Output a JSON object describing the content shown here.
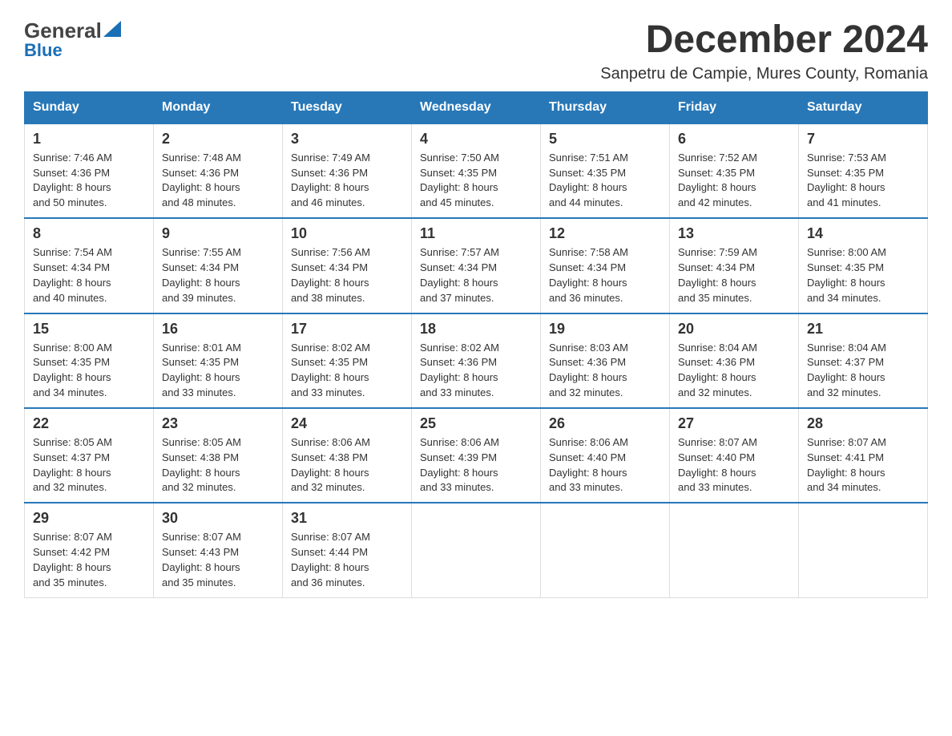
{
  "logo": {
    "general": "General",
    "blue": "Blue"
  },
  "header": {
    "title": "December 2024",
    "subtitle": "Sanpetru de Campie, Mures County, Romania"
  },
  "days_of_week": [
    "Sunday",
    "Monday",
    "Tuesday",
    "Wednesday",
    "Thursday",
    "Friday",
    "Saturday"
  ],
  "weeks": [
    [
      {
        "num": "1",
        "sunrise": "7:46 AM",
        "sunset": "4:36 PM",
        "daylight": "8 hours and 50 minutes."
      },
      {
        "num": "2",
        "sunrise": "7:48 AM",
        "sunset": "4:36 PM",
        "daylight": "8 hours and 48 minutes."
      },
      {
        "num": "3",
        "sunrise": "7:49 AM",
        "sunset": "4:36 PM",
        "daylight": "8 hours and 46 minutes."
      },
      {
        "num": "4",
        "sunrise": "7:50 AM",
        "sunset": "4:35 PM",
        "daylight": "8 hours and 45 minutes."
      },
      {
        "num": "5",
        "sunrise": "7:51 AM",
        "sunset": "4:35 PM",
        "daylight": "8 hours and 44 minutes."
      },
      {
        "num": "6",
        "sunrise": "7:52 AM",
        "sunset": "4:35 PM",
        "daylight": "8 hours and 42 minutes."
      },
      {
        "num": "7",
        "sunrise": "7:53 AM",
        "sunset": "4:35 PM",
        "daylight": "8 hours and 41 minutes."
      }
    ],
    [
      {
        "num": "8",
        "sunrise": "7:54 AM",
        "sunset": "4:34 PM",
        "daylight": "8 hours and 40 minutes."
      },
      {
        "num": "9",
        "sunrise": "7:55 AM",
        "sunset": "4:34 PM",
        "daylight": "8 hours and 39 minutes."
      },
      {
        "num": "10",
        "sunrise": "7:56 AM",
        "sunset": "4:34 PM",
        "daylight": "8 hours and 38 minutes."
      },
      {
        "num": "11",
        "sunrise": "7:57 AM",
        "sunset": "4:34 PM",
        "daylight": "8 hours and 37 minutes."
      },
      {
        "num": "12",
        "sunrise": "7:58 AM",
        "sunset": "4:34 PM",
        "daylight": "8 hours and 36 minutes."
      },
      {
        "num": "13",
        "sunrise": "7:59 AM",
        "sunset": "4:34 PM",
        "daylight": "8 hours and 35 minutes."
      },
      {
        "num": "14",
        "sunrise": "8:00 AM",
        "sunset": "4:35 PM",
        "daylight": "8 hours and 34 minutes."
      }
    ],
    [
      {
        "num": "15",
        "sunrise": "8:00 AM",
        "sunset": "4:35 PM",
        "daylight": "8 hours and 34 minutes."
      },
      {
        "num": "16",
        "sunrise": "8:01 AM",
        "sunset": "4:35 PM",
        "daylight": "8 hours and 33 minutes."
      },
      {
        "num": "17",
        "sunrise": "8:02 AM",
        "sunset": "4:35 PM",
        "daylight": "8 hours and 33 minutes."
      },
      {
        "num": "18",
        "sunrise": "8:02 AM",
        "sunset": "4:36 PM",
        "daylight": "8 hours and 33 minutes."
      },
      {
        "num": "19",
        "sunrise": "8:03 AM",
        "sunset": "4:36 PM",
        "daylight": "8 hours and 32 minutes."
      },
      {
        "num": "20",
        "sunrise": "8:04 AM",
        "sunset": "4:36 PM",
        "daylight": "8 hours and 32 minutes."
      },
      {
        "num": "21",
        "sunrise": "8:04 AM",
        "sunset": "4:37 PM",
        "daylight": "8 hours and 32 minutes."
      }
    ],
    [
      {
        "num": "22",
        "sunrise": "8:05 AM",
        "sunset": "4:37 PM",
        "daylight": "8 hours and 32 minutes."
      },
      {
        "num": "23",
        "sunrise": "8:05 AM",
        "sunset": "4:38 PM",
        "daylight": "8 hours and 32 minutes."
      },
      {
        "num": "24",
        "sunrise": "8:06 AM",
        "sunset": "4:38 PM",
        "daylight": "8 hours and 32 minutes."
      },
      {
        "num": "25",
        "sunrise": "8:06 AM",
        "sunset": "4:39 PM",
        "daylight": "8 hours and 33 minutes."
      },
      {
        "num": "26",
        "sunrise": "8:06 AM",
        "sunset": "4:40 PM",
        "daylight": "8 hours and 33 minutes."
      },
      {
        "num": "27",
        "sunrise": "8:07 AM",
        "sunset": "4:40 PM",
        "daylight": "8 hours and 33 minutes."
      },
      {
        "num": "28",
        "sunrise": "8:07 AM",
        "sunset": "4:41 PM",
        "daylight": "8 hours and 34 minutes."
      }
    ],
    [
      {
        "num": "29",
        "sunrise": "8:07 AM",
        "sunset": "4:42 PM",
        "daylight": "8 hours and 35 minutes."
      },
      {
        "num": "30",
        "sunrise": "8:07 AM",
        "sunset": "4:43 PM",
        "daylight": "8 hours and 35 minutes."
      },
      {
        "num": "31",
        "sunrise": "8:07 AM",
        "sunset": "4:44 PM",
        "daylight": "8 hours and 36 minutes."
      },
      null,
      null,
      null,
      null
    ]
  ],
  "labels": {
    "sunrise": "Sunrise: ",
    "sunset": "Sunset: ",
    "daylight": "Daylight: "
  }
}
